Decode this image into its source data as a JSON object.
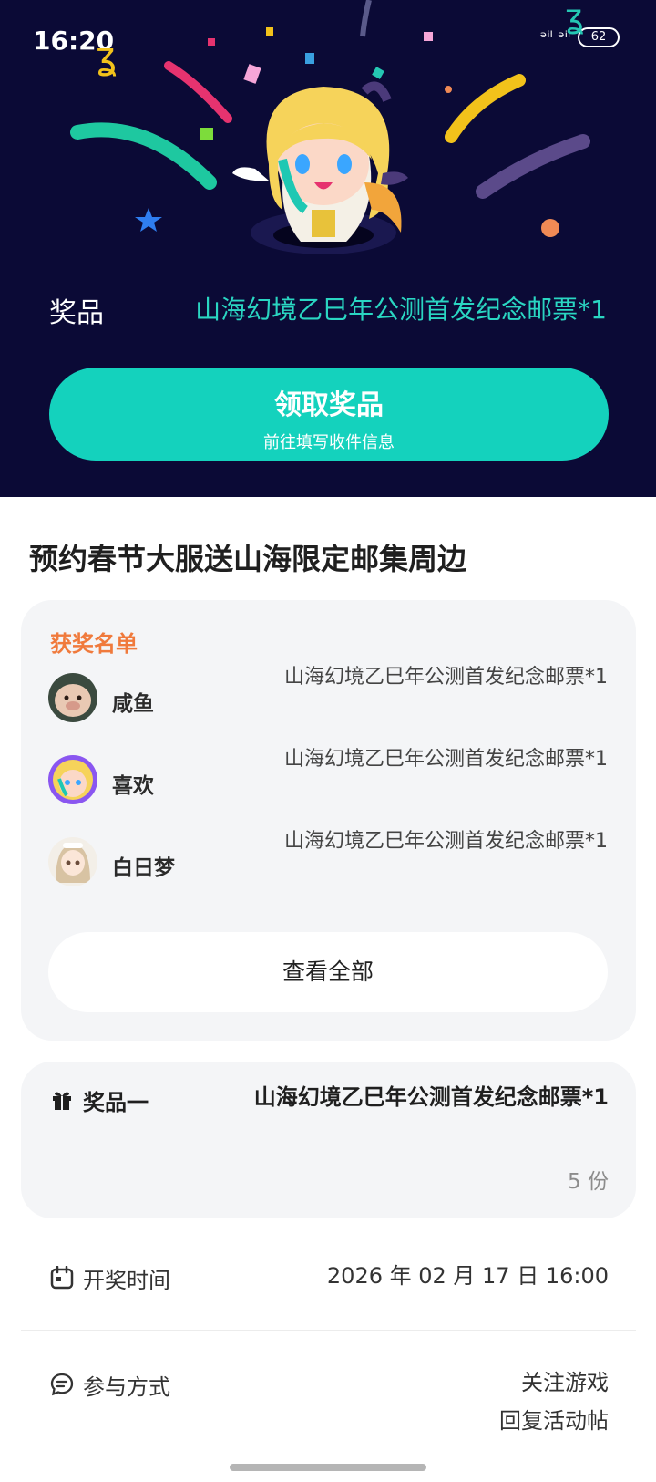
{
  "status_bar": {
    "time": "16:20",
    "signal": "ᵊⁱˡ ᵊⁱˡ",
    "battery": "62"
  },
  "hero": {
    "prize_label": "奖品",
    "prize_name": "山海幻境乙巳年公测首发纪念邮票*1",
    "claim_button": {
      "title": "领取奖品",
      "subtitle": "前往填写收件信息"
    },
    "colors": {
      "background": "#0b0a36",
      "accent": "#14d2bd"
    }
  },
  "activity": {
    "title": "预约春节大服送山海限定邮集周边"
  },
  "winners": {
    "heading": "获奖名单",
    "items": [
      {
        "name": "咸鱼",
        "prize": "山海幻境乙巳年公测首发纪念邮票*1",
        "avatar": "pig-avatar"
      },
      {
        "name": "喜欢",
        "prize": "山海幻境乙巳年公测首发纪念邮票*1",
        "avatar": "anime-avatar"
      },
      {
        "name": "白日梦",
        "prize": "山海幻境乙巳年公测首发纪念邮票*1",
        "avatar": "girl-avatar"
      }
    ],
    "view_all": "查看全部"
  },
  "prize_detail": {
    "label": "奖品一",
    "name": "山海幻境乙巳年公测首发纪念邮票*1",
    "count": "5 份",
    "icon": "gift-icon"
  },
  "draw_time": {
    "label": "开奖时间",
    "value": "2026 年 02 月 17 日 16:00",
    "icon": "calendar-icon"
  },
  "participation": {
    "label": "参与方式",
    "values": [
      "关注游戏",
      "回复活动帖"
    ],
    "icon": "chat-icon"
  }
}
